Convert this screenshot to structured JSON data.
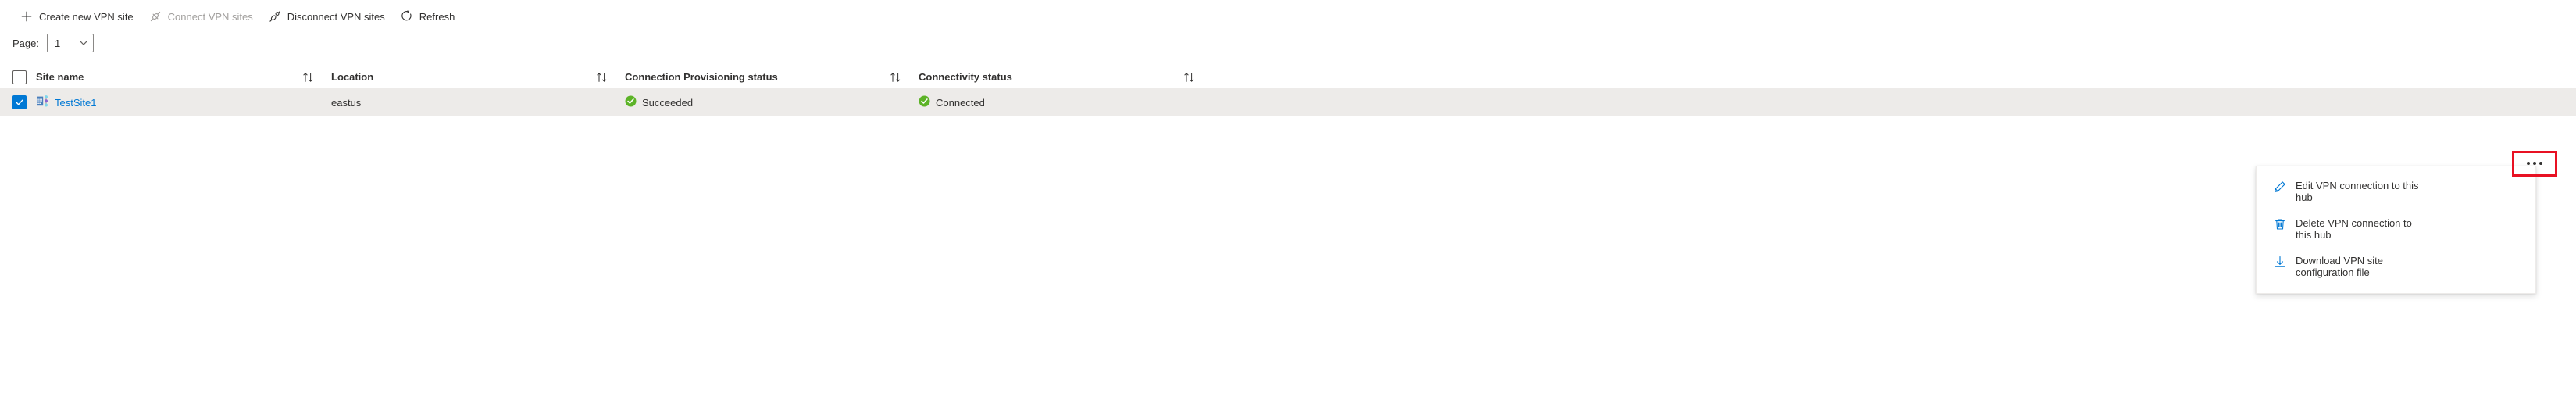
{
  "toolbar": {
    "buttons": [
      {
        "label": "Create new VPN site",
        "icon": "plus-icon",
        "disabled": false
      },
      {
        "label": "Connect VPN sites",
        "icon": "connect-plug-icon",
        "disabled": true
      },
      {
        "label": "Disconnect VPN sites",
        "icon": "disconnect-plug-icon",
        "disabled": false
      },
      {
        "label": "Refresh",
        "icon": "refresh-icon",
        "disabled": false
      }
    ]
  },
  "pager": {
    "label": "Page:",
    "value": "1",
    "options": [
      "1"
    ]
  },
  "table": {
    "columns": [
      {
        "label": "Site name",
        "sort": "sort-icon"
      },
      {
        "label": "Location",
        "sort": "sort-icon"
      },
      {
        "label": "Connection Provisioning status",
        "sort": "sort-icon"
      },
      {
        "label": "Connectivity status",
        "sort": "sort-icon"
      }
    ],
    "rows": [
      {
        "selected": true,
        "site_name": "TestSite1",
        "site_icon": "vpn-site-icon",
        "location": "eastus",
        "provisioning_status": "Succeeded",
        "provisioning_status_icon": "success-check-icon",
        "connectivity_status": "Connected",
        "connectivity_status_icon": "success-check-icon",
        "row_menu": "ellipsis-icon"
      }
    ]
  },
  "context_menu": {
    "items": [
      {
        "label": "Edit VPN connection to this hub",
        "icon": "pencil-icon"
      },
      {
        "label": "Delete VPN connection to this hub",
        "icon": "trash-icon"
      },
      {
        "label": "Download VPN site configuration file",
        "icon": "download-icon"
      }
    ]
  },
  "colors": {
    "accent": "#0078d4",
    "success": "#5cb327",
    "highlight": "#e81123",
    "row_selected_bg": "#edebe9",
    "disabled_text": "#a19f9d"
  }
}
